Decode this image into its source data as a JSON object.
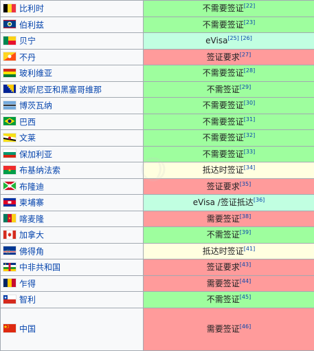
{
  "colors": {
    "free": "#9efe9e",
    "required": "#ff9b9b",
    "on_arrival": "#ffffe0",
    "evisa": "#c1ffe1",
    "link": "#0645ad",
    "border": "#a2a9b1"
  },
  "rows": [
    {
      "country": "比利时",
      "flag": "flag-belgium",
      "status": "不需要签证",
      "ref": "[22]",
      "type": "free"
    },
    {
      "country": "伯利兹",
      "flag": "flag-belize",
      "status": "不需要签证",
      "ref": "[23]",
      "type": "free"
    },
    {
      "country": "贝宁",
      "flag": "flag-benin",
      "status": "eVisa",
      "ref": "[25] [26]",
      "type": "evisa"
    },
    {
      "country": "不丹",
      "flag": "flag-bhutan",
      "status": "签证要求",
      "ref": "[27]",
      "type": "required"
    },
    {
      "country": "玻利维亚",
      "flag": "flag-bolivia",
      "status": "不需要签证",
      "ref": "[28]",
      "type": "free"
    },
    {
      "country": "波斯尼亚和黑塞哥维那",
      "flag": "flag-bosnia-herzegovina",
      "status": "不需签证",
      "ref": "[29]",
      "type": "free"
    },
    {
      "country": "博茨瓦纳",
      "flag": "flag-botswana",
      "status": "不需要签证",
      "ref": "[30]",
      "type": "free"
    },
    {
      "country": "巴西",
      "flag": "flag-brazil",
      "status": "不需要签证",
      "ref": "[31]",
      "type": "free"
    },
    {
      "country": "文莱",
      "flag": "flag-brunei",
      "status": "不需要签证",
      "ref": "[32]",
      "type": "free"
    },
    {
      "country": "保加利亚",
      "flag": "flag-bulgaria",
      "status": "不需要签证",
      "ref": "[33]",
      "type": "free"
    },
    {
      "country": "布基纳法索",
      "flag": "flag-burkina-faso",
      "status": "抵达时签证",
      "ref": "[34]",
      "type": "on_arrival"
    },
    {
      "country": "布隆迪",
      "flag": "flag-burundi",
      "status": "签证要求",
      "ref": "[35]",
      "type": "required"
    },
    {
      "country": "柬埔寨",
      "flag": "flag-cambodia",
      "status": "eVisa /签证抵达",
      "ref": "[36]",
      "type": "evisa"
    },
    {
      "country": "喀麦隆",
      "flag": "flag-cameroon",
      "status": "需要签证",
      "ref": "[38]",
      "type": "required"
    },
    {
      "country": "加拿大",
      "flag": "flag-canada",
      "status": "不需签证",
      "ref": "[39]",
      "type": "free"
    },
    {
      "country": "佛得角",
      "flag": "flag-cape-verde",
      "status": "抵达时签证",
      "ref": "[41]",
      "type": "on_arrival"
    },
    {
      "country": "中非共和国",
      "flag": "flag-central-african-republic",
      "status": "签证要求",
      "ref": "[43]",
      "type": "required"
    },
    {
      "country": "乍得",
      "flag": "flag-chad",
      "status": "需要签证",
      "ref": "[44]",
      "type": "required"
    },
    {
      "country": "智利",
      "flag": "flag-chile",
      "status": "不需签证",
      "ref": "[45]",
      "type": "free"
    },
    {
      "country": "中国",
      "flag": "flag-china",
      "status": "需要签证",
      "ref": "[46]",
      "type": "required"
    }
  ]
}
